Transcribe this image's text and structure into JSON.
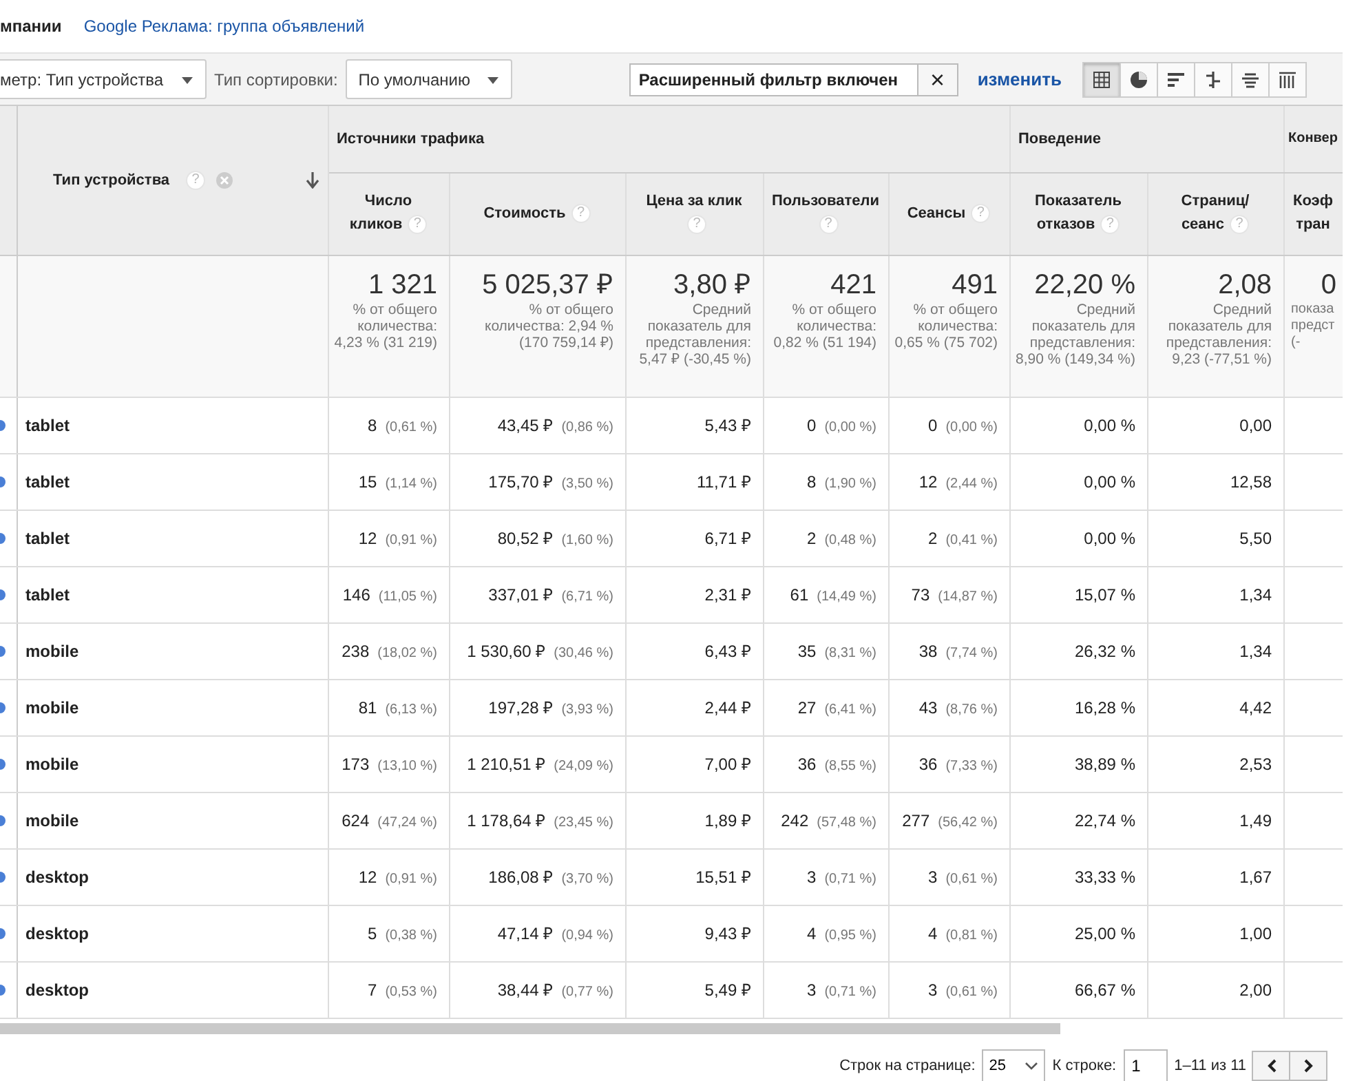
{
  "breadcrumb": {
    "current": "мпании",
    "link": "Google Реклама: группа объявлений"
  },
  "toolbar": {
    "dimension": "метр: Тип устройства",
    "sort_label": "Тип сортировки:",
    "sort_value": "По умолчанию",
    "filter_value": "Расширенный фильтр включен",
    "filter_clear": "×",
    "filter_edit": "изменить",
    "views": [
      {
        "kind": "table",
        "selected": true
      },
      {
        "kind": "pie",
        "selected": false
      },
      {
        "kind": "bars",
        "selected": false
      },
      {
        "kind": "compare",
        "selected": false
      },
      {
        "kind": "terms",
        "selected": false
      },
      {
        "kind": "pivot",
        "selected": false
      }
    ]
  },
  "table": {
    "dimension": {
      "label": "Тип устройства",
      "help": "?"
    },
    "groups": [
      {
        "label": "Источники трафика",
        "columns": [
          {
            "label": "Число кликов",
            "help": "?"
          },
          {
            "label": "Стоимость",
            "help": "?"
          },
          {
            "label": "Цена за клик",
            "help": "?"
          },
          {
            "label": "Пользователи",
            "help": "?"
          },
          {
            "label": "Сеансы",
            "help": "?"
          }
        ]
      },
      {
        "label": "Поведение",
        "columns": [
          {
            "label": "Показатель отказов",
            "help": "?"
          },
          {
            "label": "Страниц/сеанс",
            "help": "?"
          }
        ]
      },
      {
        "label": "Конвер",
        "columns": [
          {
            "label": "Коэф тран"
          }
        ]
      }
    ],
    "totals": [
      {
        "value": "1 321",
        "note": "% от общего количества: 4,23 % (31 219)"
      },
      {
        "value": "5 025,37 ₽",
        "note": "% от общего количества: 2,94 % (170 759,14 ₽)"
      },
      {
        "value": "3,80 ₽",
        "note": "Средний показатель для представления: 5,47 ₽ (-30,45 %)"
      },
      {
        "value": "421",
        "note": "% от общего количества: 0,82 % (51 194)"
      },
      {
        "value": "491",
        "note": "% от общего количества: 0,65 % (75 702)"
      },
      {
        "value": "22,20 %",
        "note": "Средний показатель для представления: 8,90 % (149,34 %)"
      },
      {
        "value": "2,08",
        "note": "Средний показатель для представления: 9,23 (-77,51 %)"
      },
      {
        "value": "0",
        "note": "показа предст (-"
      }
    ],
    "rows": [
      {
        "device": "tablet",
        "cells": [
          [
            "8",
            "(0,61 %)"
          ],
          [
            "43,45 ₽",
            "(0,86 %)"
          ],
          [
            "5,43 ₽"
          ],
          [
            "0",
            "(0,00 %)"
          ],
          [
            "0",
            "(0,00 %)"
          ],
          [
            "0,00 %"
          ],
          [
            "0,00"
          ]
        ]
      },
      {
        "device": "tablet",
        "cells": [
          [
            "15",
            "(1,14 %)"
          ],
          [
            "175,70 ₽",
            "(3,50 %)"
          ],
          [
            "11,71 ₽"
          ],
          [
            "8",
            "(1,90 %)"
          ],
          [
            "12",
            "(2,44 %)"
          ],
          [
            "0,00 %"
          ],
          [
            "12,58"
          ]
        ]
      },
      {
        "device": "tablet",
        "cells": [
          [
            "12",
            "(0,91 %)"
          ],
          [
            "80,52 ₽",
            "(1,60 %)"
          ],
          [
            "6,71 ₽"
          ],
          [
            "2",
            "(0,48 %)"
          ],
          [
            "2",
            "(0,41 %)"
          ],
          [
            "0,00 %"
          ],
          [
            "5,50"
          ]
        ]
      },
      {
        "device": "tablet",
        "cells": [
          [
            "146",
            "(11,05 %)"
          ],
          [
            "337,01 ₽",
            "(6,71 %)"
          ],
          [
            "2,31 ₽"
          ],
          [
            "61",
            "(14,49 %)"
          ],
          [
            "73",
            "(14,87 %)"
          ],
          [
            "15,07 %"
          ],
          [
            "1,34"
          ]
        ]
      },
      {
        "device": "mobile",
        "cells": [
          [
            "238",
            "(18,02 %)"
          ],
          [
            "1 530,60 ₽",
            "(30,46 %)"
          ],
          [
            "6,43 ₽"
          ],
          [
            "35",
            "(8,31 %)"
          ],
          [
            "38",
            "(7,74 %)"
          ],
          [
            "26,32 %"
          ],
          [
            "1,34"
          ]
        ]
      },
      {
        "device": "mobile",
        "cells": [
          [
            "81",
            "(6,13 %)"
          ],
          [
            "197,28 ₽",
            "(3,93 %)"
          ],
          [
            "2,44 ₽"
          ],
          [
            "27",
            "(6,41 %)"
          ],
          [
            "43",
            "(8,76 %)"
          ],
          [
            "16,28 %"
          ],
          [
            "4,42"
          ]
        ]
      },
      {
        "device": "mobile",
        "cells": [
          [
            "173",
            "(13,10 %)"
          ],
          [
            "1 210,51 ₽",
            "(24,09 %)"
          ],
          [
            "7,00 ₽"
          ],
          [
            "36",
            "(8,55 %)"
          ],
          [
            "36",
            "(7,33 %)"
          ],
          [
            "38,89 %"
          ],
          [
            "2,53"
          ]
        ]
      },
      {
        "device": "mobile",
        "cells": [
          [
            "624",
            "(47,24 %)"
          ],
          [
            "1 178,64 ₽",
            "(23,45 %)"
          ],
          [
            "1,89 ₽"
          ],
          [
            "242",
            "(57,48 %)"
          ],
          [
            "277",
            "(56,42 %)"
          ],
          [
            "22,74 %"
          ],
          [
            "1,49"
          ]
        ]
      },
      {
        "device": "desktop",
        "cells": [
          [
            "12",
            "(0,91 %)"
          ],
          [
            "186,08 ₽",
            "(3,70 %)"
          ],
          [
            "15,51 ₽"
          ],
          [
            "3",
            "(0,71 %)"
          ],
          [
            "3",
            "(0,61 %)"
          ],
          [
            "33,33 %"
          ],
          [
            "1,67"
          ]
        ]
      },
      {
        "device": "desktop",
        "cells": [
          [
            "5",
            "(0,38 %)"
          ],
          [
            "47,14 ₽",
            "(0,94 %)"
          ],
          [
            "9,43 ₽"
          ],
          [
            "4",
            "(0,95 %)"
          ],
          [
            "4",
            "(0,81 %)"
          ],
          [
            "25,00 %"
          ],
          [
            "1,00"
          ]
        ]
      },
      {
        "device": "desktop",
        "cells": [
          [
            "7",
            "(0,53 %)"
          ],
          [
            "38,44 ₽",
            "(0,77 %)"
          ],
          [
            "5,49 ₽"
          ],
          [
            "3",
            "(0,71 %)"
          ],
          [
            "3",
            "(0,61 %)"
          ],
          [
            "66,67 %"
          ],
          [
            "2,00"
          ]
        ]
      }
    ]
  },
  "pager": {
    "rows_label": "Строк на странице:",
    "rows_value": "25",
    "goto_label": "К строке:",
    "goto_value": "1",
    "range": "1–11 из 11"
  }
}
